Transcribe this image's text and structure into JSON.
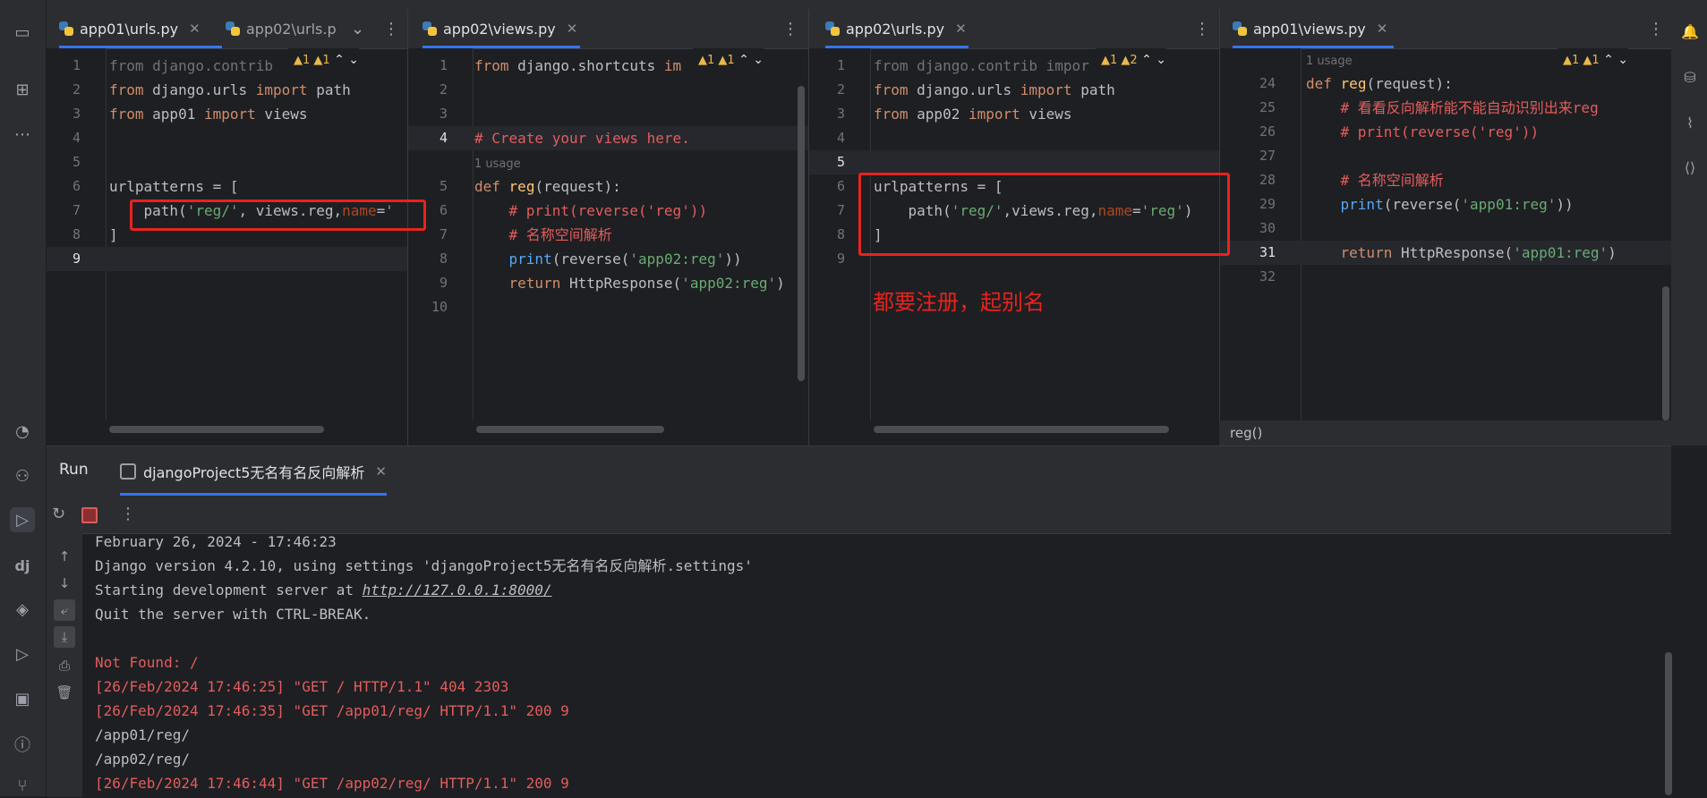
{
  "panes": [
    {
      "tabs": [
        {
          "label": "app01\\urls.py",
          "active": true
        },
        {
          "label": "app02\\urls.p",
          "active": false
        }
      ],
      "inspect": "▲1 ▲1",
      "lines": [
        {
          "n": "1",
          "html": "<span class='dimc'>from django.contrib</span>"
        },
        {
          "n": "2",
          "html": "<span class='kw'>from</span> django.urls <span class='kw'>import</span> path"
        },
        {
          "n": "3",
          "html": "<span class='kw'>from</span> app01 <span class='kw'>import</span> views"
        },
        {
          "n": "4",
          "html": ""
        },
        {
          "n": "5",
          "html": ""
        },
        {
          "n": "6",
          "html": "urlpatterns = ["
        },
        {
          "n": "7",
          "html": "    path(<span class='str'>'reg/'</span>, views.reg,<span class='param'>name</span>=<span class='str'>'</span>"
        },
        {
          "n": "8",
          "html": "]"
        },
        {
          "n": "9",
          "html": ""
        }
      ]
    },
    {
      "tabs": [
        {
          "label": "app02\\views.py",
          "active": true
        }
      ],
      "inspect": "▲1 ▲1",
      "lines": [
        {
          "n": "1",
          "html": "<span class='kw'>from</span> django.shortcuts <span class='kw'>im</span>"
        },
        {
          "n": "2",
          "html": ""
        },
        {
          "n": "3",
          "html": ""
        },
        {
          "n": "4",
          "html": "<span class='com'># Create your views here.</span>"
        },
        {
          "n": "",
          "html": "<span class='usage'>1 usage</span>"
        },
        {
          "n": "5",
          "html": "<span class='kw'>def</span> <span class='def'>reg</span>(request):"
        },
        {
          "n": "6",
          "html": "    <span class='com'># print(reverse('reg'))</span>"
        },
        {
          "n": "7",
          "html": "    <span class='com'># 名称空间解析</span>"
        },
        {
          "n": "8",
          "html": "    <span class='fn'>print</span>(reverse(<span class='str'>'app02:reg'</span>))"
        },
        {
          "n": "9",
          "html": "    <span class='kw'>return</span> HttpResponse(<span class='str'>'app02:reg'</span>)"
        },
        {
          "n": "10",
          "html": ""
        }
      ]
    },
    {
      "tabs": [
        {
          "label": "app02\\urls.py",
          "active": true
        }
      ],
      "inspect": "▲1 ▲2",
      "lines": [
        {
          "n": "1",
          "html": "<span class='dimc'>from django.contrib impor</span>"
        },
        {
          "n": "2",
          "html": "<span class='kw'>from</span> django.urls <span class='kw'>import</span> path"
        },
        {
          "n": "3",
          "html": "<span class='kw'>from</span> app02 <span class='kw'>import</span> views"
        },
        {
          "n": "4",
          "html": ""
        },
        {
          "n": "5",
          "html": ""
        },
        {
          "n": "6",
          "html": "urlpatterns = ["
        },
        {
          "n": "7",
          "html": "    path(<span class='str'>'reg/'</span>,views.reg,<span class='param'>name</span>=<span class='str'>'reg'</span>)"
        },
        {
          "n": "8",
          "html": "]"
        },
        {
          "n": "9",
          "html": ""
        }
      ]
    },
    {
      "tabs": [
        {
          "label": "app01\\views.py",
          "active": true
        }
      ],
      "inspect": "▲1 ▲1",
      "lines": [
        {
          "n": "",
          "html": "<span class='usage'>1 usage</span>"
        },
        {
          "n": "24",
          "html": "<span class='kw'>def</span> <span class='def'>reg</span>(request):"
        },
        {
          "n": "25",
          "html": "    <span class='com'># 看看反向解析能不能自动识别出来reg</span>"
        },
        {
          "n": "26",
          "html": "    <span class='com'># print(reverse('reg'))</span>"
        },
        {
          "n": "27",
          "html": ""
        },
        {
          "n": "28",
          "html": "    <span class='com'># 名称空间解析</span>"
        },
        {
          "n": "29",
          "html": "    <span class='fn'>print</span>(reverse(<span class='str'>'app01:reg'</span>))"
        },
        {
          "n": "30",
          "html": ""
        },
        {
          "n": "31",
          "html": "    <span class='kw'>return</span> HttpResponse(<span class='str'>'app01:reg'</span>)"
        },
        {
          "n": "32",
          "html": ""
        }
      ]
    }
  ],
  "annotation": "都要注册，起别名",
  "breadcrumb_hint": "reg()",
  "run": {
    "title": "Run",
    "tab_label": "djangoProject5无名有名反向解析",
    "console": [
      {
        "text": "February 26, 2024 - 17:46:23",
        "err": false
      },
      {
        "text": "Django version 4.2.10, using settings 'djangoProject5无名有名反向解析.settings'",
        "err": false
      },
      {
        "text": "Starting development server at ",
        "link": "http://127.0.0.1:8000/",
        "err": false
      },
      {
        "text": "Quit the server with CTRL-BREAK.",
        "err": false
      },
      {
        "text": "",
        "err": false
      },
      {
        "text": "Not Found: /",
        "err": true
      },
      {
        "text": "[26/Feb/2024 17:46:25] \"GET / HTTP/1.1\" 404 2303",
        "err": true
      },
      {
        "text": "[26/Feb/2024 17:46:35] \"GET /app01/reg/ HTTP/1.1\" 200 9",
        "err": true
      },
      {
        "text": "/app01/reg/",
        "err": false
      },
      {
        "text": "/app02/reg/",
        "err": false
      },
      {
        "text": "[26/Feb/2024 17:46:44] \"GET /app02/reg/ HTTP/1.1\" 200 9",
        "err": true
      }
    ]
  }
}
